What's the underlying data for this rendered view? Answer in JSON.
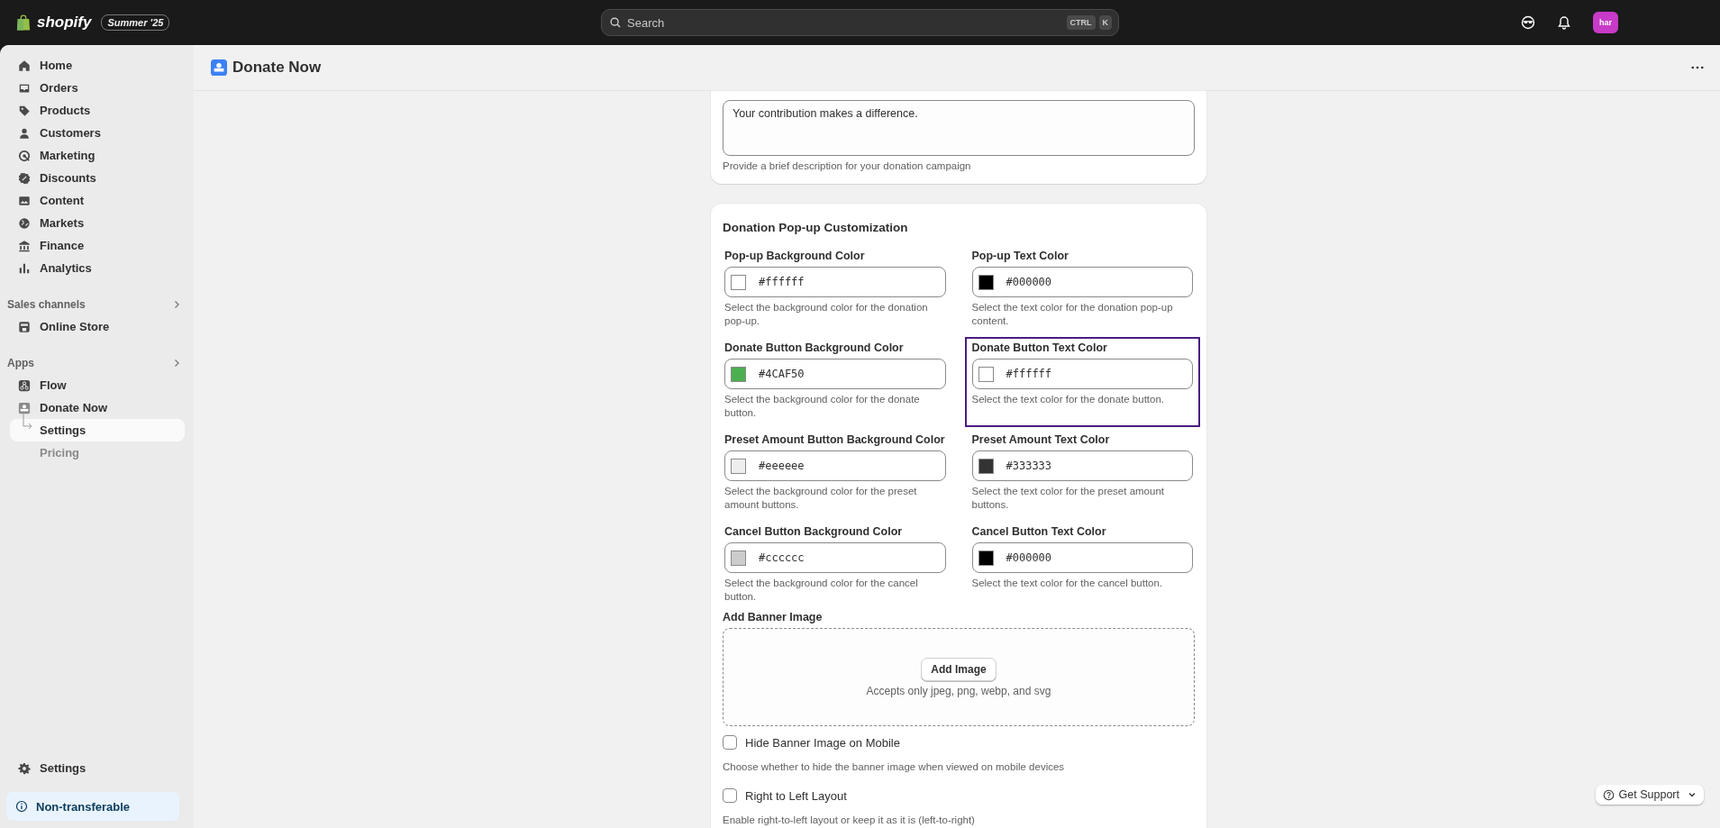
{
  "top_bar": {
    "logo_text": "shopify",
    "edition_badge": "Summer '25",
    "search": {
      "placeholder": "Search",
      "shortcut_keys": [
        "CTRL",
        "K"
      ]
    },
    "avatar_initials": "har"
  },
  "sidebar": {
    "items": [
      {
        "label": "Home",
        "selected": false
      },
      {
        "label": "Orders",
        "selected": false
      },
      {
        "label": "Products",
        "selected": false
      },
      {
        "label": "Customers",
        "selected": false
      },
      {
        "label": "Marketing",
        "selected": false
      },
      {
        "label": "Discounts",
        "selected": false
      },
      {
        "label": "Content",
        "selected": false
      },
      {
        "label": "Markets",
        "selected": false
      },
      {
        "label": "Finance",
        "selected": false
      },
      {
        "label": "Analytics",
        "selected": false
      }
    ],
    "sections": [
      {
        "title": "Sales channels",
        "items": [
          {
            "label": "Online Store",
            "selected": false
          }
        ]
      },
      {
        "title": "Apps",
        "items": [
          {
            "label": "Flow",
            "selected": false
          },
          {
            "label": "Donate Now",
            "selected": false,
            "children": [
              {
                "label": "Settings",
                "selected": true
              },
              {
                "label": "Pricing",
                "selected": false
              }
            ]
          }
        ]
      }
    ],
    "footer_item": {
      "label": "Settings"
    },
    "notice": "Non-transferable"
  },
  "page": {
    "title": "Donate Now"
  },
  "description_card": {
    "value": "Your contribution makes a difference.",
    "help": "Provide a brief description for your donation campaign"
  },
  "customization_card": {
    "title": "Donation Pop-up Customization",
    "color_fields": [
      {
        "label": "Pop-up Background Color",
        "value": "#ffffff",
        "color": "#ffffff",
        "help": "Select the background color for the donation pop-up.",
        "highlighted": false
      },
      {
        "label": "Pop-up Text Color",
        "value": "#000000",
        "color": "#000000",
        "help": "Select the text color for the donation pop-up content.",
        "highlighted": false
      },
      {
        "label": "Donate Button Background Color",
        "value": "#4CAF50",
        "color": "#4caf50",
        "help": "Select the background color for the donate button.",
        "highlighted": false
      },
      {
        "label": "Donate Button Text Color",
        "value": "#ffffff",
        "color": "#ffffff",
        "help": "Select the text color for the donate button.",
        "highlighted": true
      },
      {
        "label": "Preset Amount Button Background Color",
        "value": "#eeeeee",
        "color": "#eeeeee",
        "help": "Select the background color for the preset amount buttons.",
        "highlighted": false
      },
      {
        "label": "Preset Amount Text Color",
        "value": "#333333",
        "color": "#333333",
        "help": "Select the text color for the preset amount buttons.",
        "highlighted": false
      },
      {
        "label": "Cancel Button Background Color",
        "value": "#cccccc",
        "color": "#cccccc",
        "help": "Select the background color for the cancel button.",
        "highlighted": false
      },
      {
        "label": "Cancel Button Text Color",
        "value": "#000000",
        "color": "#000000",
        "help": "Select the text color for the cancel button.",
        "highlighted": false
      }
    ],
    "banner": {
      "label": "Add Banner Image",
      "button": "Add Image",
      "hint": "Accepts only jpeg, png, webp, and svg"
    },
    "options": [
      {
        "label": "Hide Banner Image on Mobile",
        "checked": false,
        "help": "Choose whether to hide the banner image when viewed on mobile devices"
      },
      {
        "label": "Right to Left Layout",
        "checked": false,
        "help": "Enable right-to-left layout or keep it as it is (left-to-right)"
      }
    ]
  },
  "support_button": {
    "label": "Get Support"
  }
}
